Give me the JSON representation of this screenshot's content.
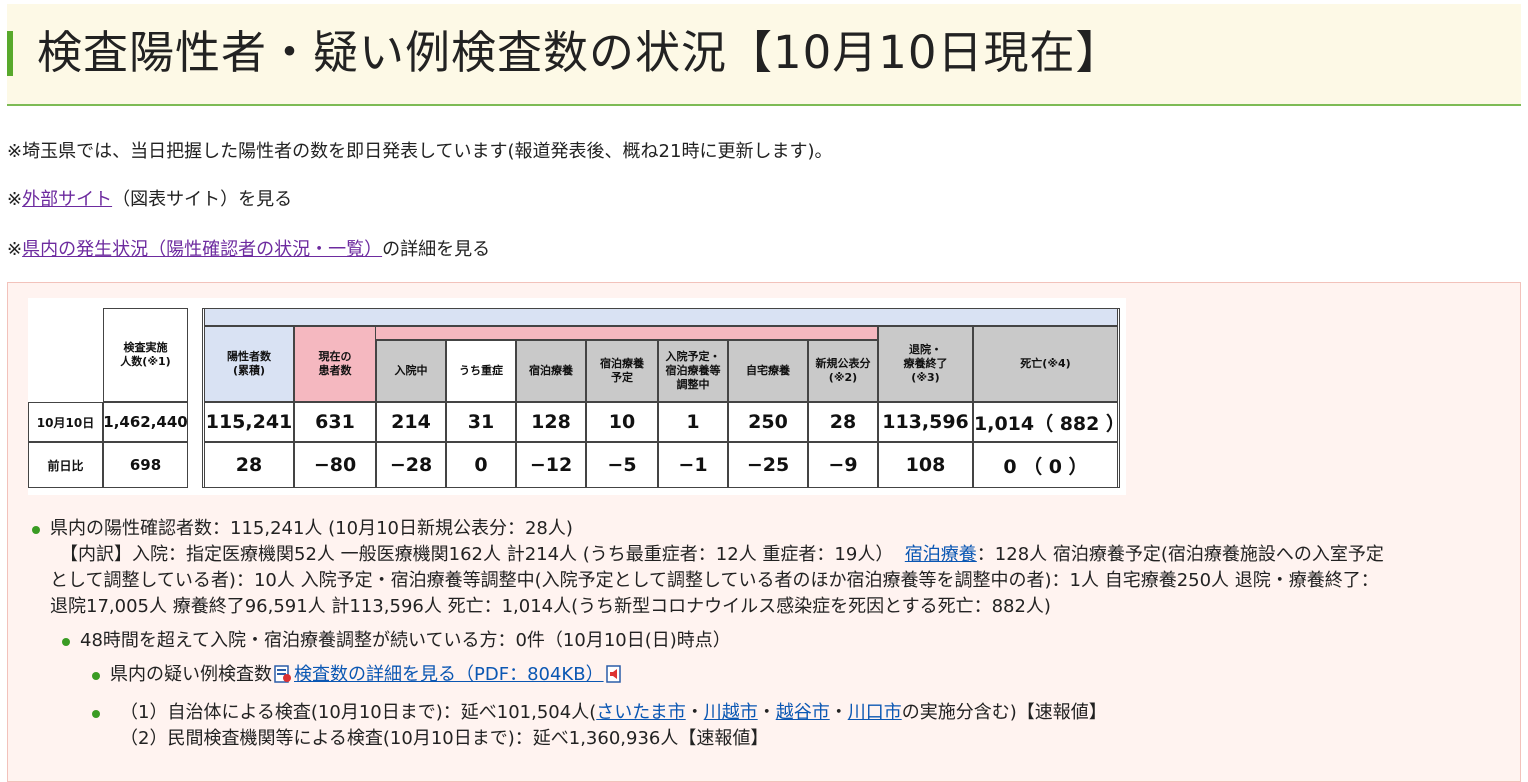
{
  "heading": "検査陽性者・疑い例検査数の状況【10月10日現在】",
  "notes": {
    "publish_note": "※埼玉県では、当日把握した陽性者の数を即日発表しています(報道発表後、概ね21時に更新します)。",
    "external_prefix": "※",
    "external_link": "外部サイト",
    "external_suffix": "（図表サイト）を見る",
    "detail_prefix": "※",
    "detail_link": "県内の発生状況（陽性確認者の状況・一覧）",
    "detail_suffix": "の詳細を見る"
  },
  "table": {
    "headers": {
      "tested": "検査実施\n人数(※1)",
      "positives": "陽性者数\n(累積)",
      "current": "現在の\n患者数",
      "hospitalized": "入院中",
      "severe": "うち重症",
      "hotel": "宿泊療養",
      "hotel_planned": "宿泊療養\n予定",
      "adjusting": "入院予定・\n宿泊療養等\n調整中",
      "home": "自宅療養",
      "new_announced": "新規公表分\n(※2)",
      "discharged": "退院・\n療養終了\n(※3)",
      "deaths": "死亡(※4)"
    },
    "rows": [
      {
        "label": "10月10日",
        "tested": "1,462,440",
        "positives": "115,241",
        "current": "631",
        "hospitalized": "214",
        "severe": "31",
        "hotel": "128",
        "hotel_planned": "10",
        "adjusting": "1",
        "home": "250",
        "new_announced": "28",
        "discharged": "113,596",
        "deaths": "1,014（ 882 ）"
      },
      {
        "label": "前日比",
        "tested": "698",
        "positives": "28",
        "current": "−80",
        "hospitalized": "−28",
        "severe": "0",
        "hotel": "−12",
        "hotel_planned": "−5",
        "adjusting": "−1",
        "home": "−25",
        "new_announced": "−9",
        "discharged": "108",
        "deaths": "0 （ 0 ）"
      }
    ],
    "colors": {
      "blue_header": "#d9e2f3",
      "pink_header": "#f5b8c0",
      "gray_header": "#c9c9c9"
    }
  },
  "summary": {
    "positives_line": "県内の陽性確認者数：115,241人 (10月10日新規公表分：28人)",
    "breakdown_1": "【内訳】入院：指定医療機関52人 一般医療機関162人 計214人 (うち最重症者：12人 重症者：19人）",
    "breakdown_link": "宿泊療養",
    "breakdown_2": "：128人 宿泊療養予定(宿泊療養施設への入室予定",
    "breakdown_3": "として調整している者)：10人 入院予定・宿泊療養等調整中(入院予定として調整している者のほか宿泊療養等を調整中の者)：1人 自宅療養250人 退院・療養終了：",
    "breakdown_4": "退院17,005人 療養終了96,591人 計113,596人 死亡：1,014人(うち新型コロナウイルス感染症を死因とする死亡：882人)",
    "waiting_line": "48時間を超えて入院・宿泊療養調整が続いている方：0件（10月10日(日)時点）",
    "suspect_prefix": "県内の疑い例検査数",
    "suspect_link": "検査数の詳細を見る（PDF：804KB）",
    "local_1": "（1）自治体による検査(10月10日まで)：延べ101,504人(",
    "city_saitama": "さいたま市",
    "sep": "・",
    "city_kawagoe": "川越市",
    "city_koshigaya": "越谷市",
    "city_kawaguchi": "川口市",
    "local_1_suffix": "の実施分含む)【速報値】",
    "local_2": "（2）民間検査機関等による検査(10月10日まで)：延べ1,360,936人【速報値】"
  }
}
